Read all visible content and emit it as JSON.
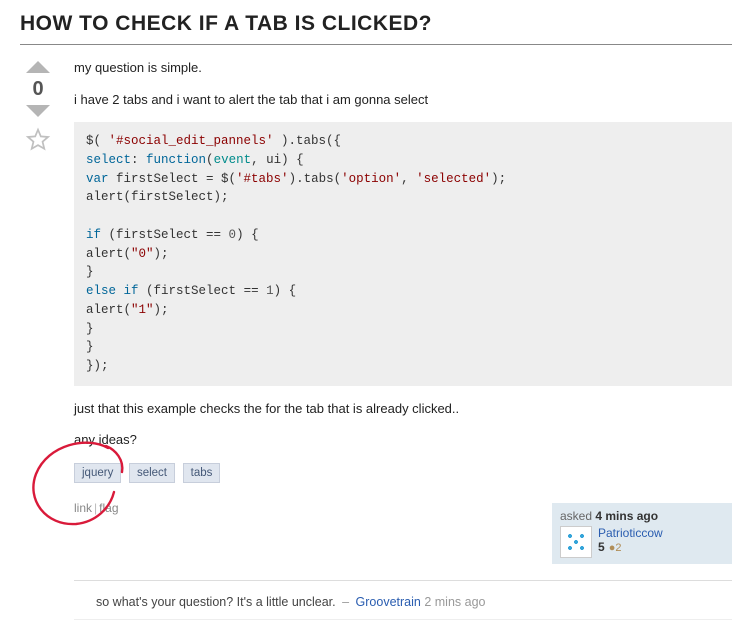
{
  "title": "HOW TO CHECK IF A TAB IS CLICKED?",
  "vote_count": "0",
  "post": {
    "p1": "my question is simple.",
    "p2": "i have 2 tabs and i want to alert the tab that i am gonna select",
    "p3": "just that this example checks the for the tab that is already clicked..",
    "p4": "any ideas?"
  },
  "code": {
    "l1a": "$( ",
    "l1b": "'#social_edit_pannels'",
    "l1c": " ).tabs({",
    "l2a": "select",
    "l2b": ": ",
    "l2c": "function",
    "l2d": "(",
    "l2e": "event",
    "l2f": ", ui) {",
    "l3a": "var",
    "l3b": " firstSelect = $(",
    "l3c": "'#tabs'",
    "l3d": ").tabs(",
    "l3e": "'option'",
    "l3f": ", ",
    "l3g": "'selected'",
    "l3h": ");",
    "l4": "alert(firstSelect);",
    "l5a": "if",
    "l5b": " (firstSelect == ",
    "l5c": "0",
    "l5d": ") {",
    "l6a": "alert(",
    "l6b": "\"0\"",
    "l6c": ");",
    "l7": "}",
    "l8a": "else",
    "l8b": " ",
    "l8c": "if",
    "l8d": " (firstSelect == ",
    "l8e": "1",
    "l8f": ") {",
    "l9a": "alert(",
    "l9b": "\"1\"",
    "l9c": ");",
    "l10": "}",
    "l11": "}",
    "l12": "});"
  },
  "tags": [
    "jquery",
    "select",
    "tabs"
  ],
  "actions": {
    "link": "link",
    "flag": "flag"
  },
  "usercard": {
    "asked_prefix": "asked ",
    "asked_time": "4 mins ago",
    "username": "Patrioticcow",
    "rep": "5",
    "bronze": "2"
  },
  "comment": {
    "text": "so what's your question? It's a little unclear.",
    "user": "Groovetrain",
    "age": "2 mins ago"
  }
}
